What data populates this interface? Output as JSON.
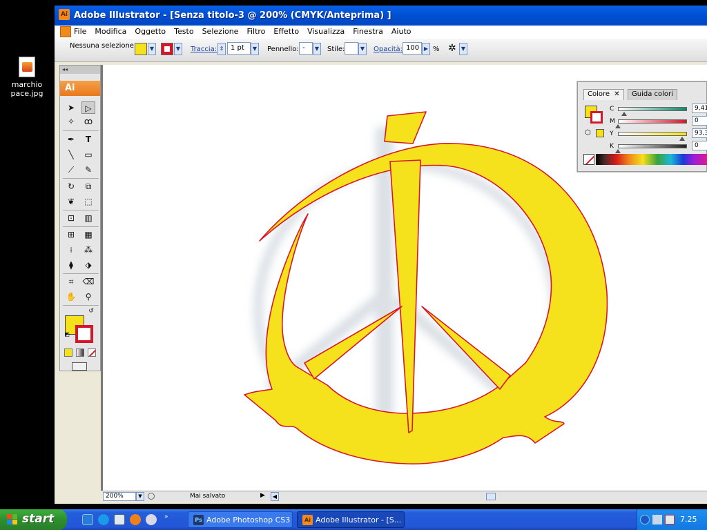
{
  "desktop": {
    "icon_label_line1": "marchio",
    "icon_label_line2": "pace.jpg"
  },
  "window": {
    "app_badge": "Ai",
    "title": "Adobe Illustrator - [Senza titolo-3 @ 200% (CMYK/Anteprima) ]"
  },
  "menubar": {
    "items": [
      "File",
      "Modifica",
      "Oggetto",
      "Testo",
      "Selezione",
      "Filtro",
      "Effetto",
      "Visualizza",
      "Finestra",
      "Aiuto"
    ]
  },
  "controlbar": {
    "selection_label": "Nessuna selezione",
    "stroke_link": "Traccia:",
    "stroke_weight": "1 pt",
    "brush_label": "Pennello:",
    "brush_value": "-",
    "style_label": "Stile:",
    "opacity_link": "Opacità:",
    "opacity_value": "100",
    "opacity_unit": "%"
  },
  "tools": {
    "header": "Ai",
    "collapse": "◂◂"
  },
  "statusbar": {
    "zoom": "200%",
    "status_text": "Mai salvato"
  },
  "color_panel": {
    "tab_active": "Colore",
    "tab_inactive": "Guida colori",
    "channels": [
      {
        "label": "C",
        "value": "9,41",
        "color": "#0e8a6a",
        "level": 0.09
      },
      {
        "label": "M",
        "value": "0",
        "color": "#d8162a",
        "level": 0.0
      },
      {
        "label": "Y",
        "value": "93,3",
        "color": "#f5e11c",
        "level": 0.93
      },
      {
        "label": "K",
        "value": "0",
        "color": "#222222",
        "level": 0.0
      }
    ]
  },
  "colors": {
    "fill": "#f5e11c",
    "stroke": "#d8162a",
    "canvas": "#ffffff"
  },
  "taskbar": {
    "start_label": "start",
    "tasks": [
      {
        "label": "Adobe Photoshop CS3",
        "badge": "Ps"
      },
      {
        "label": "Adobe Illustrator - [S...",
        "badge": "Ai"
      }
    ],
    "clock": "7.25"
  }
}
